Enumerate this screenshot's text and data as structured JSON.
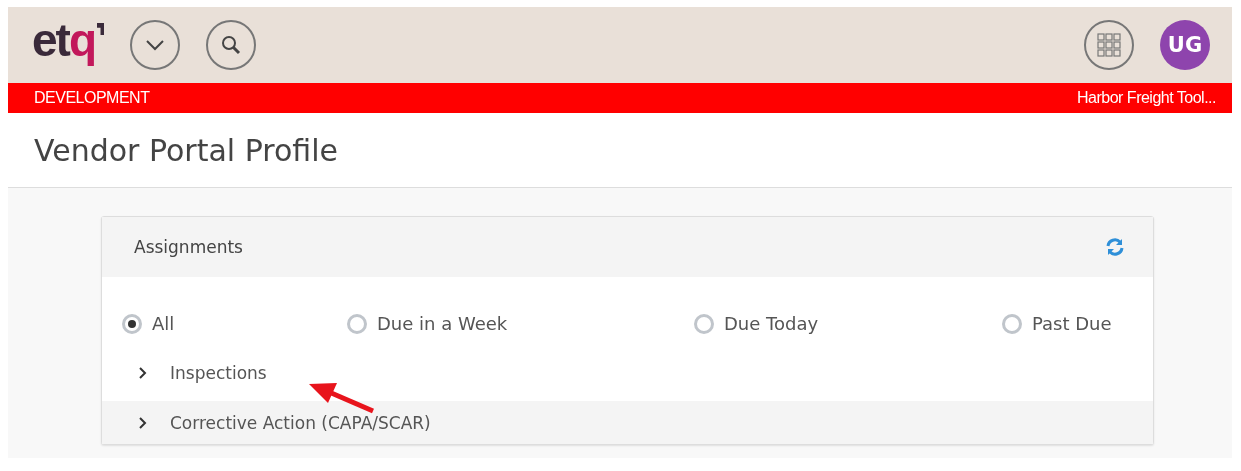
{
  "header": {
    "logo": {
      "main": "et",
      "accent": "q"
    },
    "avatar_initials": "UG"
  },
  "environment_bar": {
    "environment": "DEVELOPMENT",
    "company": "Harbor Freight Tool..."
  },
  "page_title": "Vendor Portal Profile",
  "assignments": {
    "title": "Assignments",
    "filters": [
      {
        "label": "All",
        "selected": true
      },
      {
        "label": "Due in a Week",
        "selected": false
      },
      {
        "label": "Due Today",
        "selected": false
      },
      {
        "label": "Past Due",
        "selected": false
      }
    ],
    "groups": [
      {
        "label": "Inspections",
        "expanded": false
      },
      {
        "label": "Corrective Action (CAPA/SCAR)",
        "expanded": false
      }
    ]
  }
}
